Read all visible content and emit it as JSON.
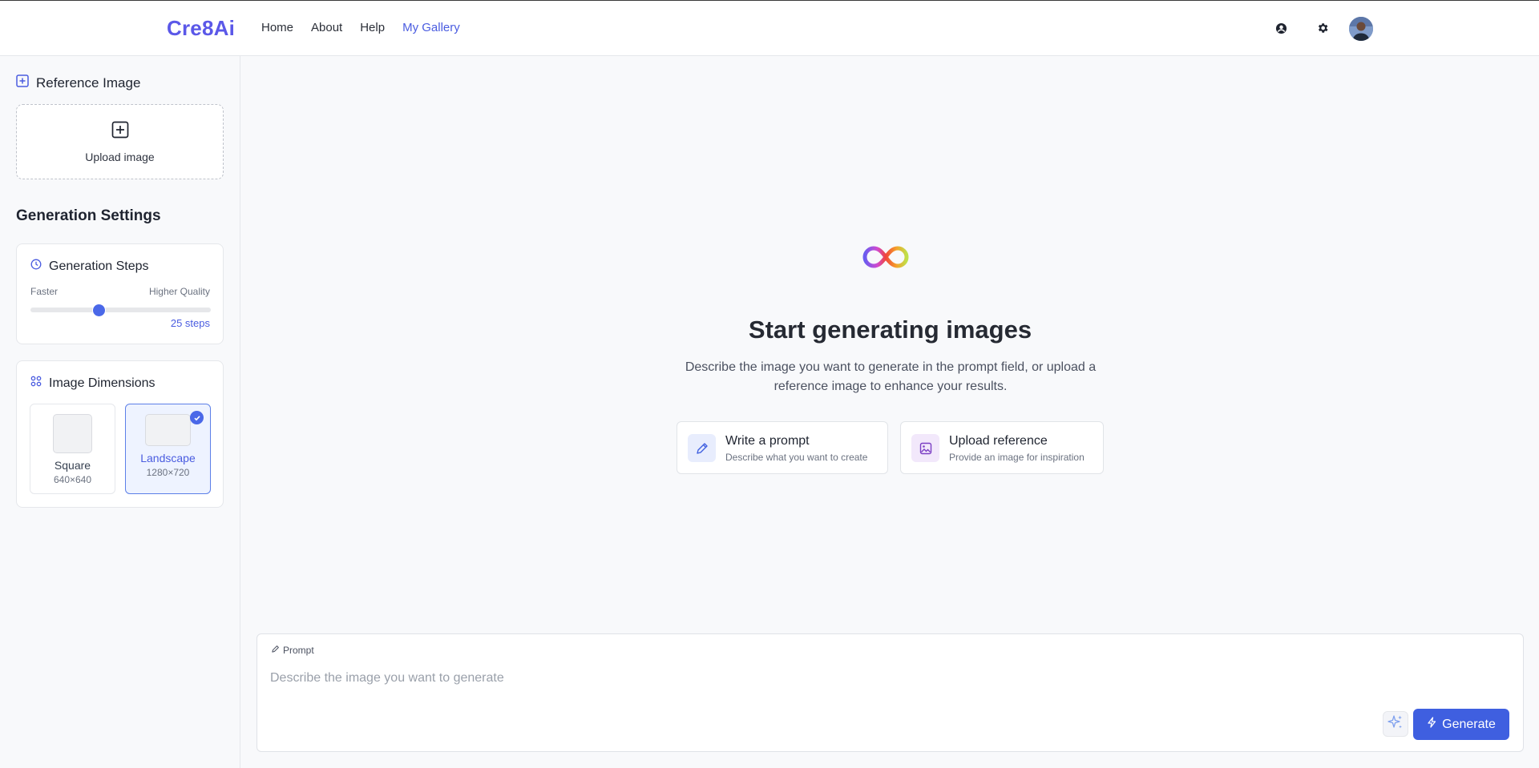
{
  "app": {
    "logo": "Cre8Ai"
  },
  "nav": [
    {
      "label": "Home",
      "active": false
    },
    {
      "label": "About",
      "active": false
    },
    {
      "label": "Help",
      "active": false
    },
    {
      "label": "My Gallery",
      "active": true
    }
  ],
  "header_icons": [
    "user-circle-icon",
    "gear-icon",
    "avatar"
  ],
  "sidebar": {
    "reference": {
      "title": "Reference Image",
      "upload_label": "Upload image"
    },
    "settings_title": "Generation Settings",
    "steps": {
      "title": "Generation Steps",
      "min_label": "Faster",
      "max_label": "Higher Quality",
      "value_label": "25 steps",
      "value": 25,
      "fraction": 0.38
    },
    "dimensions": {
      "title": "Image Dimensions",
      "options": [
        {
          "name": "Square",
          "size": "640×640",
          "selected": false
        },
        {
          "name": "Landscape",
          "size": "1280×720",
          "selected": true
        }
      ]
    }
  },
  "main": {
    "empty_title": "Start generating images",
    "empty_desc": "Describe the image you want to generate in the prompt field, or upload a reference image to enhance your results.",
    "actions": [
      {
        "title": "Write a prompt",
        "subtitle": "Describe what you want to create",
        "icon": "pencil-icon"
      },
      {
        "title": "Upload reference",
        "subtitle": "Provide an image for inspiration",
        "icon": "image-icon"
      }
    ],
    "prompt": {
      "label": "Prompt",
      "placeholder": "Describe the image you want to generate",
      "value": "",
      "generate_label": "Generate"
    }
  },
  "colors": {
    "accent": "#4a5ce0",
    "button": "#3f5fe0",
    "background": "#f8f9fb"
  }
}
